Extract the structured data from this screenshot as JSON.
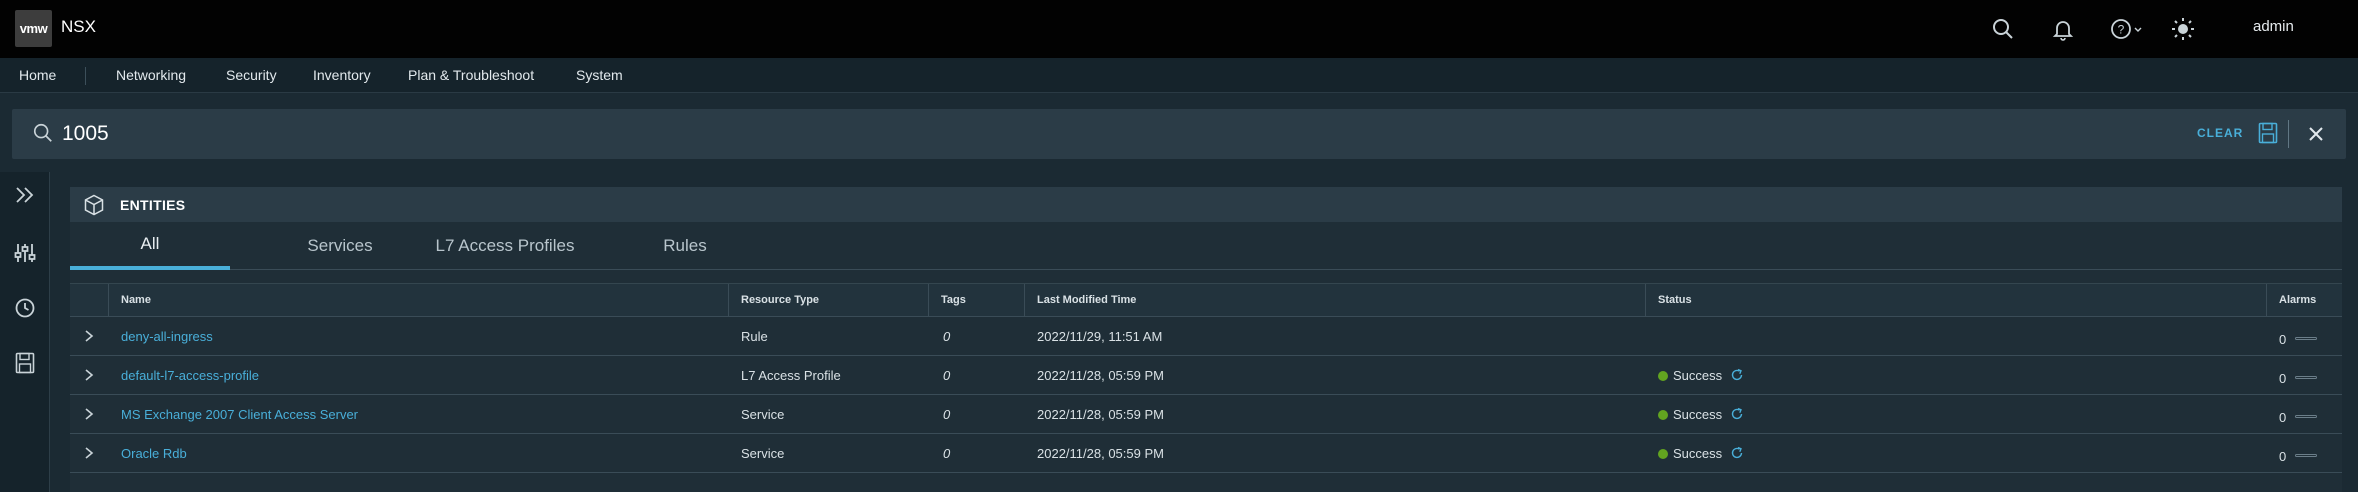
{
  "header": {
    "logo_text": "vmw",
    "app_title": "NSX",
    "user": "admin",
    "icons": [
      "search-icon",
      "bell-icon",
      "help-icon",
      "brightness-icon"
    ]
  },
  "nav": {
    "items": [
      "Home",
      "Networking",
      "Security",
      "Inventory",
      "Plan & Troubleshoot",
      "System"
    ]
  },
  "search": {
    "value": "1005",
    "clear_label": "CLEAR"
  },
  "entities": {
    "title": "ENTITIES",
    "tabs": [
      "All",
      "Services",
      "L7 Access Profiles",
      "Rules"
    ],
    "active_tab": "All",
    "columns": [
      "Name",
      "Resource Type",
      "Tags",
      "Last Modified Time",
      "Status",
      "Alarms"
    ],
    "rows": [
      {
        "name": "deny-all-ingress",
        "type": "Rule",
        "tags": "0",
        "modified": "2022/11/29, 11:51 AM",
        "status": "",
        "alarms": "0"
      },
      {
        "name": "default-l7-access-profile",
        "type": "L7 Access Profile",
        "tags": "0",
        "modified": "2022/11/28, 05:59 PM",
        "status": "Success",
        "alarms": "0"
      },
      {
        "name": "MS Exchange 2007 Client Access Server",
        "type": "Service",
        "tags": "0",
        "modified": "2022/11/28, 05:59 PM",
        "status": "Success",
        "alarms": "0"
      },
      {
        "name": "Oracle Rdb",
        "type": "Service",
        "tags": "0",
        "modified": "2022/11/28, 05:59 PM",
        "status": "Success",
        "alarms": "0"
      }
    ]
  },
  "colors": {
    "accent": "#49afd9",
    "success": "#62a420",
    "header_bg": "#020202",
    "panel_bg": "#1f2e37"
  }
}
